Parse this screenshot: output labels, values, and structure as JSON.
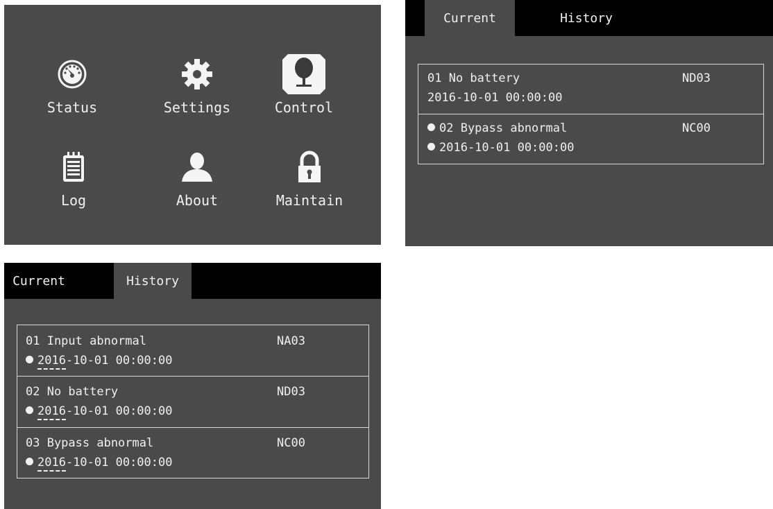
{
  "menu": {
    "items": [
      {
        "label": "Status",
        "icon": "gauge-icon"
      },
      {
        "label": "Settings",
        "icon": "gear-icon"
      },
      {
        "label": "Control",
        "icon": "control-icon"
      },
      {
        "label": "Log",
        "icon": "notepad-icon"
      },
      {
        "label": "About",
        "icon": "person-icon"
      },
      {
        "label": "Maintain",
        "icon": "lock-icon"
      }
    ]
  },
  "current_view": {
    "tabs": {
      "current": "Current",
      "history": "History"
    },
    "active_tab": "Current",
    "rows": [
      {
        "name": "01 No battery",
        "code": "ND03",
        "time": "2016-10-01 00:00:00"
      },
      {
        "name": "02 Bypass abnormal",
        "code": "NC00",
        "time": "2016-10-01 00:00:00"
      }
    ]
  },
  "history_view": {
    "tabs": {
      "current": "Current",
      "history": "History"
    },
    "active_tab": "History",
    "rows": [
      {
        "name": "01 Input abnormal",
        "code": "NA03",
        "time_year_prefix": "2016",
        "time_rest": "-10-01 00:00:00"
      },
      {
        "name": "02 No battery",
        "code": "ND03",
        "time_year_prefix": "2016",
        "time_rest": "-10-01 00:00:00"
      },
      {
        "name": "03 Bypass abnormal",
        "code": "NC00",
        "time_year_prefix": "2016",
        "time_rest": "-10-01 00:00:00"
      }
    ]
  },
  "colors": {
    "panel": "#4a4a4a",
    "tabbar": "#000000",
    "text": "#f0f0f0",
    "border": "#d8d8d8"
  }
}
